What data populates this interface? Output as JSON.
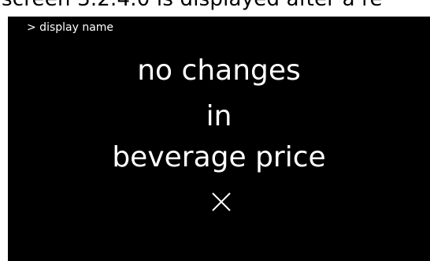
{
  "caption": {
    "text": "screen 3.2.4.0 is displayed after a re"
  },
  "screen": {
    "breadcrumb": "> display name",
    "message": {
      "line1": "no changes",
      "line2": "in",
      "line3": "beverage price"
    },
    "close_icon": "close-icon"
  },
  "colors": {
    "screen_background": "#000000",
    "text": "#ffffff",
    "page_background": "#ffffff"
  }
}
